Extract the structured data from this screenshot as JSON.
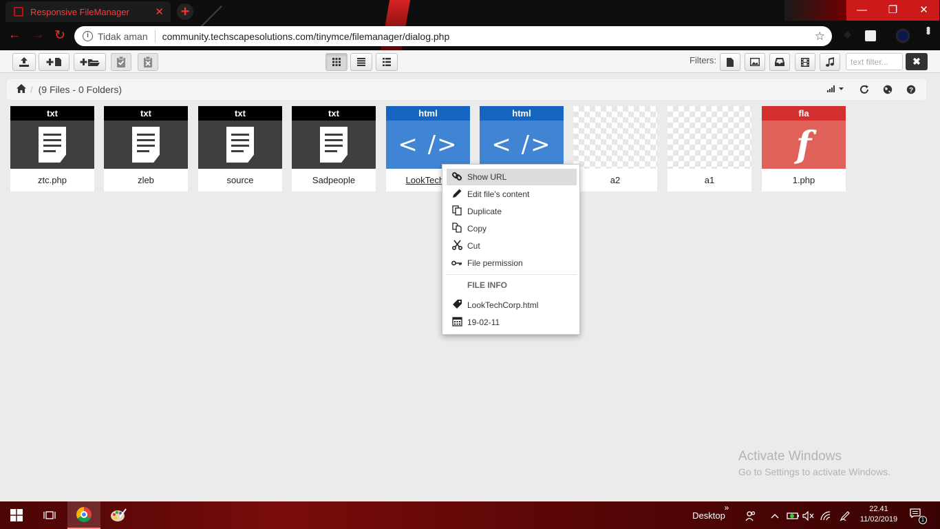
{
  "browser": {
    "tab_title": "Responsive FileManager",
    "tab_close": "✕",
    "new_tab": "+",
    "security_label": "Tidak aman",
    "url": "community.techscapesolutions.com/tinymce/filemanager/dialog.php",
    "window_min": "—",
    "window_restore": "❐",
    "window_close": "✕"
  },
  "toolbar": {
    "filters_label": "Filters:",
    "text_filter_placeholder": "text filter...",
    "clear_filter": "✖"
  },
  "breadcrumb": {
    "summary": "(9 Files - 0 Folders)"
  },
  "files": [
    {
      "ext": "txt",
      "name": "ztc.php",
      "type": "txt"
    },
    {
      "ext": "txt",
      "name": "zleb",
      "type": "txt"
    },
    {
      "ext": "txt",
      "name": "source",
      "type": "txt"
    },
    {
      "ext": "txt",
      "name": "Sadpeople",
      "type": "txt"
    },
    {
      "ext": "html",
      "name": "LookTechC",
      "type": "html",
      "thumb": "< />"
    },
    {
      "ext": "html",
      "name": "",
      "type": "html",
      "thumb": "< />"
    },
    {
      "ext": "",
      "name": "a2",
      "type": "img"
    },
    {
      "ext": "",
      "name": "a1",
      "type": "img"
    },
    {
      "ext": "fla",
      "name": "1.php",
      "type": "fla",
      "thumb": "f"
    }
  ],
  "context_menu": {
    "items": [
      {
        "label": "Show URL",
        "icon": "link-icon"
      },
      {
        "label": "Edit file's content",
        "icon": "pencil-icon"
      },
      {
        "label": "Duplicate",
        "icon": "duplicate-icon"
      },
      {
        "label": "Copy",
        "icon": "copy-icon"
      },
      {
        "label": "Cut",
        "icon": "scissors-icon"
      },
      {
        "label": "File permission",
        "icon": "key-icon"
      }
    ],
    "info_header": "FILE INFO",
    "info_filename": "LookTechCorp.html",
    "info_date": "19-02-11"
  },
  "watermark": {
    "title": "Activate Windows",
    "subtitle": "Go to Settings to activate Windows."
  },
  "taskbar": {
    "desktop_label": "Desktop",
    "chevron": "»",
    "time": "22.41",
    "date": "11/02/2019",
    "notification_count": "1"
  }
}
